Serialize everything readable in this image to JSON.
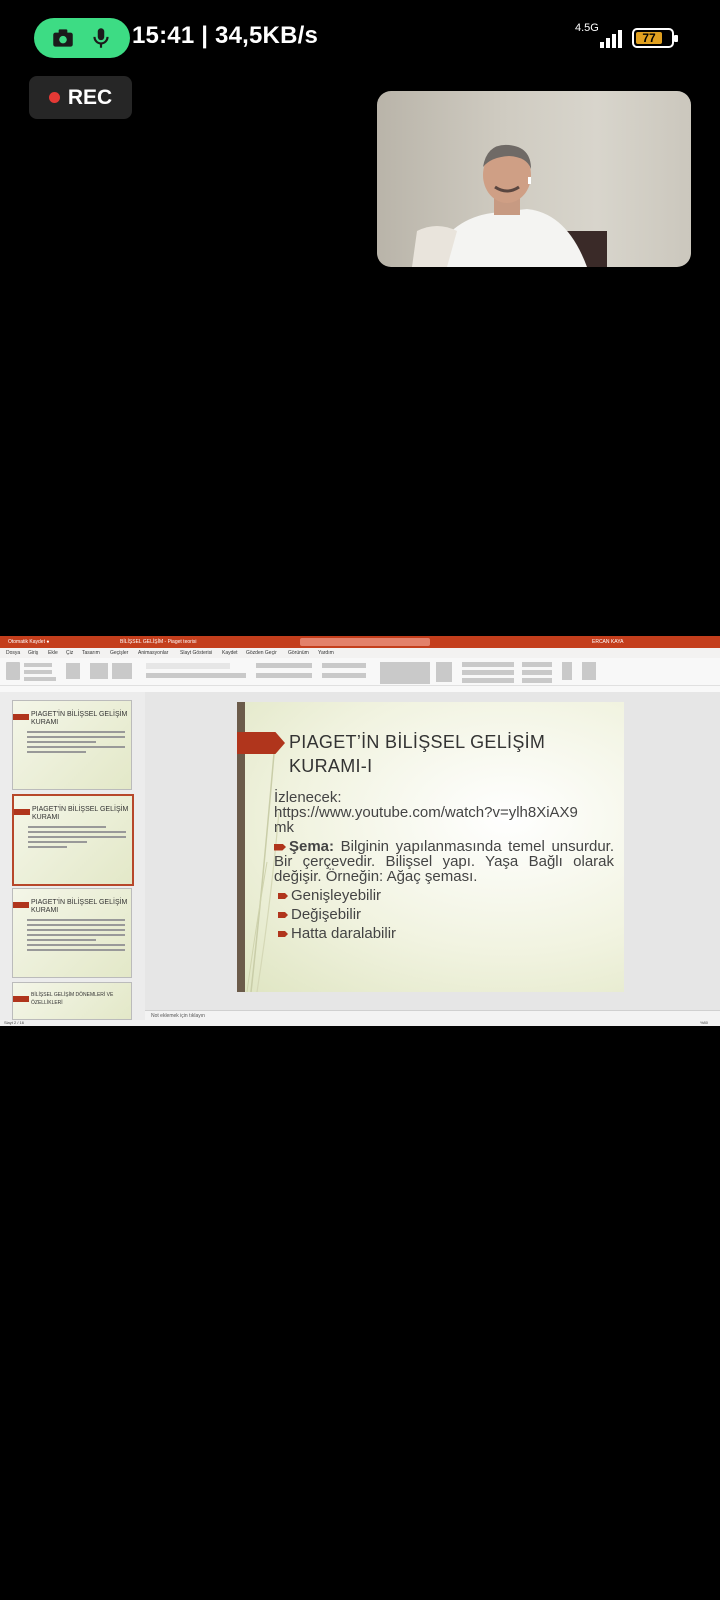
{
  "status_bar": {
    "time_rate": "15:41 | 34,5KB/s",
    "network": "4.5G",
    "battery": "77",
    "accent_color": "#3ddc84"
  },
  "recording": {
    "label": "REC"
  },
  "powerpoint": {
    "window_title": "BİLİŞSEL GELİŞİM - Piaget teorisi",
    "user": "ERCAN KAYA",
    "menu": [
      "Dosya",
      "Giriş",
      "Ekle",
      "Çiz",
      "Tasarım",
      "Geçişler",
      "Animasyonlar",
      "Slayt Gösterisi",
      "Kaydet",
      "Gözden Geçir",
      "Görünüm",
      "Yardım"
    ],
    "thumbnails": [
      {
        "num": "1",
        "title": "PIAGET'İN BİLİŞSEL GELİŞİM KURAMI"
      },
      {
        "num": "2",
        "title": "PIAGET'İN BİLİŞSEL GELİŞİM KURAMI"
      },
      {
        "num": "3",
        "title": "PIAGET'İN BİLİŞSEL GELİŞİM KURAMI"
      },
      {
        "num": "4",
        "title": "BİLİŞSEL GELİŞİM DÖNEMLERİ VE ÖZELLİKLERİ"
      }
    ],
    "notes_placeholder": "Not eklemek için tıklayın",
    "status_left": "Slayt 2 / 16",
    "zoom": "%80"
  },
  "slide": {
    "title_line1": "PIAGET’İN BİLİŞSEL GELİŞİM",
    "title_line2": "KURAMI-I",
    "izlenecek_label": "İzlenecek:",
    "url_line1": "https://www.youtube.com/watch?v=ylh8XiAX9",
    "url_line2": "mk",
    "sema_term": "Şema:",
    "sema_text": " Bilginin yapılanmasında temel unsurdur. Bir çerçevedir. Bilişsel yapı. Yaşa Bağlı olarak değişir. Örneğin: Ağaç şeması.",
    "sub_bullets": [
      "Genişleyebilir",
      "Değişebilir",
      "Hatta daralabilir"
    ]
  }
}
